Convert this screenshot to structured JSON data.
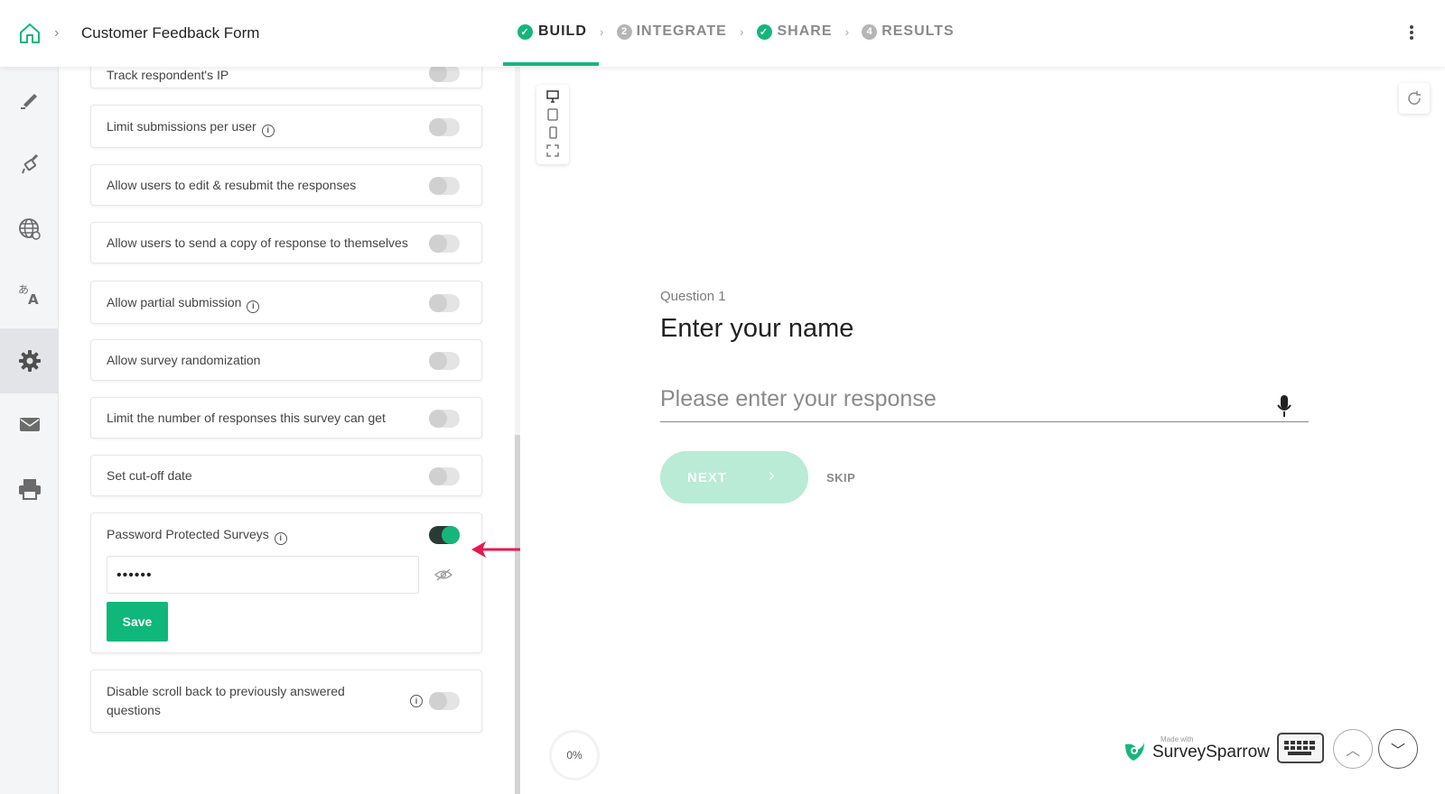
{
  "header": {
    "title": "Customer Feedback Form",
    "steps": [
      {
        "label": "BUILD",
        "badge": "✓",
        "state": "active"
      },
      {
        "label": "INTEGRATE",
        "badge": "2",
        "state": "pending"
      },
      {
        "label": "SHARE",
        "badge": "✓",
        "state": "done"
      },
      {
        "label": "RESULTS",
        "badge": "4",
        "state": "pending"
      }
    ]
  },
  "sidebar": {
    "items": [
      "edit-icon",
      "paint-brush-icon",
      "globe-icon",
      "translate-icon",
      "gear-icon",
      "mail-icon",
      "printer-icon"
    ],
    "active": "gear-icon"
  },
  "settings": {
    "track_ip": "Track respondent's IP",
    "limit_per_user": "Limit submissions per user",
    "edit_resubmit": "Allow users to edit & resubmit the responses",
    "send_copy": "Allow users to send a copy of response to themselves",
    "partial": "Allow partial submission",
    "randomization": "Allow survey randomization",
    "limit_responses": "Limit the number of responses this survey can get",
    "cutoff": "Set cut-off date",
    "password": "Password Protected Surveys",
    "password_value": "••••••",
    "save_label": "Save",
    "disable_scroll": "Disable scroll back to previously answered questions"
  },
  "preview": {
    "question_number": "Question 1",
    "question_title": "Enter your name",
    "placeholder": "Please enter your response",
    "next_label": "NEXT",
    "skip_label": "SKIP",
    "progress": "0%",
    "made_with": "Made with",
    "brand": "SurveySparrow"
  },
  "colors": {
    "accent": "#16b67a",
    "annotation_arrow": "#e8174f"
  }
}
